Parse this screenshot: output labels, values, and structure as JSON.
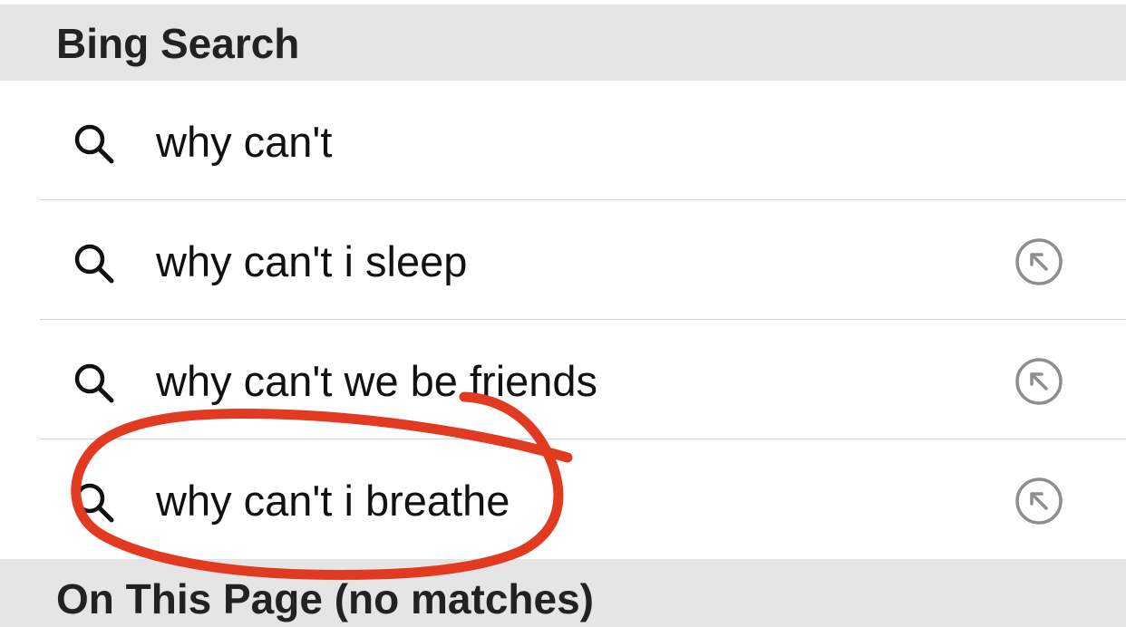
{
  "sections": {
    "bing_header": "Bing Search",
    "on_page_header": "On This Page (no matches)"
  },
  "suggestions": [
    {
      "label": "why can't",
      "icon": "search-icon",
      "has_fill_button": false
    },
    {
      "label": "why can't i sleep",
      "icon": "search-icon",
      "has_fill_button": true,
      "fill_icon": "arrow-up-left-circle-icon"
    },
    {
      "label": "why can't we be friends",
      "icon": "search-icon",
      "has_fill_button": true,
      "fill_icon": "arrow-up-left-circle-icon"
    },
    {
      "label": "why can't i breathe",
      "icon": "search-icon",
      "has_fill_button": true,
      "fill_icon": "arrow-up-left-circle-icon"
    }
  ],
  "colors": {
    "section_background": "#e5e5e5",
    "annotation_stroke": "#e23a21",
    "fill_button": "#8e8e8e"
  }
}
